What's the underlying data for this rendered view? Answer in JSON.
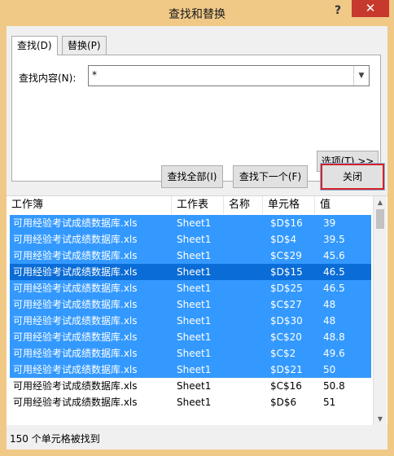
{
  "window": {
    "title": "查找和替换",
    "help": "?",
    "close_glyph": "✕"
  },
  "tabs": [
    {
      "label": "查找(D)"
    },
    {
      "label": "替换(P)"
    }
  ],
  "find": {
    "label": "查找内容(N):",
    "value": "*",
    "dropdown_glyph": "▼"
  },
  "buttons": {
    "options": "选项(T) >>",
    "find_all": "查找全部(I)",
    "find_next": "查找下一个(F)",
    "close": "关闭"
  },
  "results": {
    "columns": [
      "工作簿",
      "工作表",
      "名称",
      "单元格",
      "值"
    ],
    "rows": [
      {
        "book": "可用经验考试成绩数据库.xls",
        "sheet": "Sheet1",
        "name": "",
        "cell": "$D$16",
        "value": "39",
        "state": "selected"
      },
      {
        "book": "可用经验考试成绩数据库.xls",
        "sheet": "Sheet1",
        "name": "",
        "cell": "$D$4",
        "value": "39.5",
        "state": "selected"
      },
      {
        "book": "可用经验考试成绩数据库.xls",
        "sheet": "Sheet1",
        "name": "",
        "cell": "$C$29",
        "value": "45.6",
        "state": "selected"
      },
      {
        "book": "可用经验考试成绩数据库.xls",
        "sheet": "Sheet1",
        "name": "",
        "cell": "$D$15",
        "value": "46.5",
        "state": "focused"
      },
      {
        "book": "可用经验考试成绩数据库.xls",
        "sheet": "Sheet1",
        "name": "",
        "cell": "$D$25",
        "value": "46.5",
        "state": "selected"
      },
      {
        "book": "可用经验考试成绩数据库.xls",
        "sheet": "Sheet1",
        "name": "",
        "cell": "$C$27",
        "value": "48",
        "state": "selected"
      },
      {
        "book": "可用经验考试成绩数据库.xls",
        "sheet": "Sheet1",
        "name": "",
        "cell": "$D$30",
        "value": "48",
        "state": "selected"
      },
      {
        "book": "可用经验考试成绩数据库.xls",
        "sheet": "Sheet1",
        "name": "",
        "cell": "$C$20",
        "value": "48.8",
        "state": "selected"
      },
      {
        "book": "可用经验考试成绩数据库.xls",
        "sheet": "Sheet1",
        "name": "",
        "cell": "$C$2",
        "value": "49.6",
        "state": "selected"
      },
      {
        "book": "可用经验考试成绩数据库.xls",
        "sheet": "Sheet1",
        "name": "",
        "cell": "$D$21",
        "value": "50",
        "state": "selected"
      },
      {
        "book": "可用经验考试成绩数据库.xls",
        "sheet": "Sheet1",
        "name": "",
        "cell": "$C$16",
        "value": "50.8",
        "state": "normal"
      },
      {
        "book": "可用经验考试成绩数据库.xls",
        "sheet": "Sheet1",
        "name": "",
        "cell": "$D$6",
        "value": "51",
        "state": "normal"
      }
    ]
  },
  "status": "150 个单元格被找到",
  "colors": {
    "selection": "#3399ff",
    "focus": "#0a6cd6",
    "close_highlight": "#d0222a",
    "titlebar": "#f0c987",
    "window_close": "#c7392c"
  },
  "icons": {
    "help": "help-icon",
    "close": "close-icon",
    "dropdown": "chevron-down-icon"
  }
}
